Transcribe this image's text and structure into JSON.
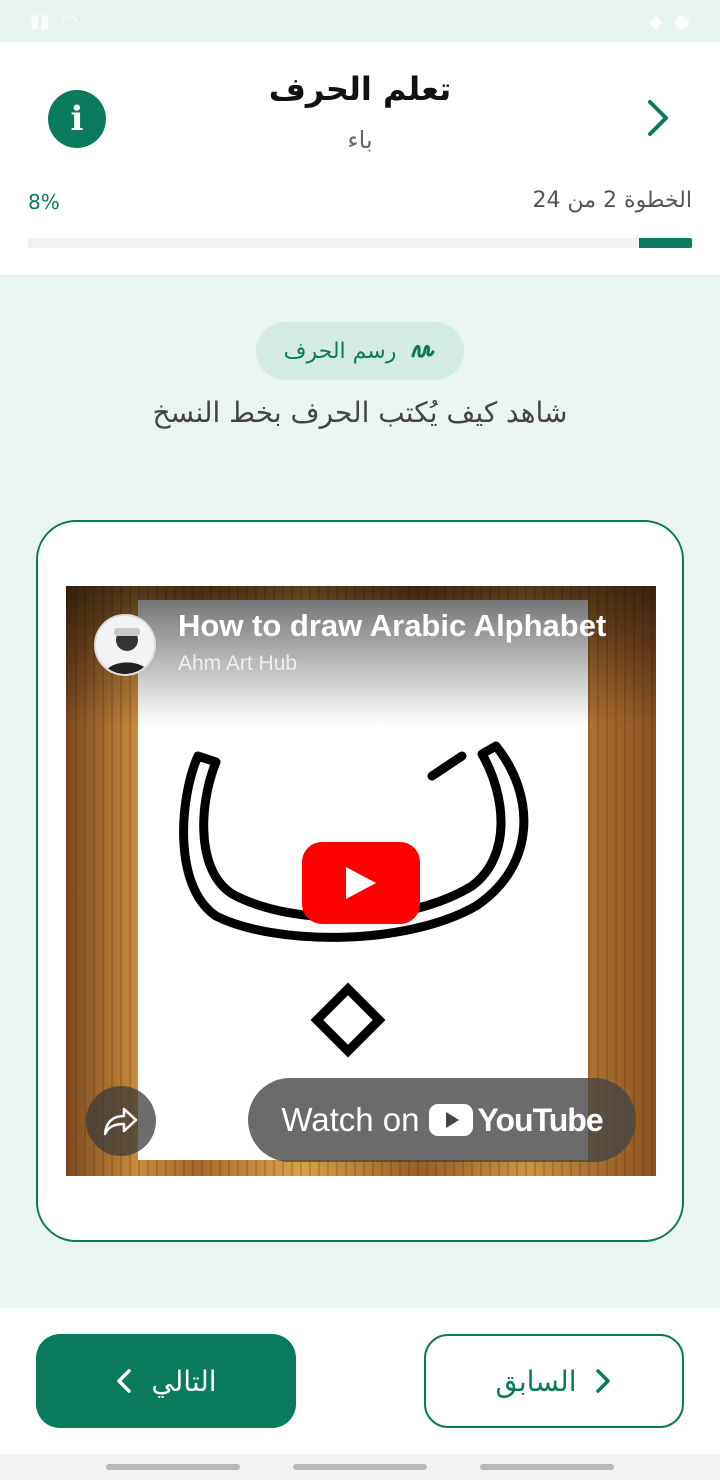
{
  "header": {
    "title": "تعلم الحرف",
    "subtitle": "باء",
    "step_text": "الخطوة 2 من 24",
    "percent_text": "8%",
    "progress_fraction": 0.08,
    "info_icon": "info-icon",
    "back_icon": "chevron-right-icon"
  },
  "section": {
    "chip_label": "رسم الحرف",
    "chip_icon": "handwriting-icon",
    "instruction": "شاهد كيف يُكتب الحرف بخط النسخ"
  },
  "video": {
    "title": "How to draw Arabic Alphabet",
    "channel": "Ahm Art Hub",
    "watch_label": "Watch on",
    "youtube_label": "YouTube",
    "play_icon": "play-icon",
    "share_icon": "share-icon"
  },
  "footer": {
    "next_label": "التالي",
    "prev_label": "السابق"
  },
  "colors": {
    "accent": "#0a7a5c",
    "background": "#eaf5f1",
    "youtube_red": "#ff0000"
  }
}
